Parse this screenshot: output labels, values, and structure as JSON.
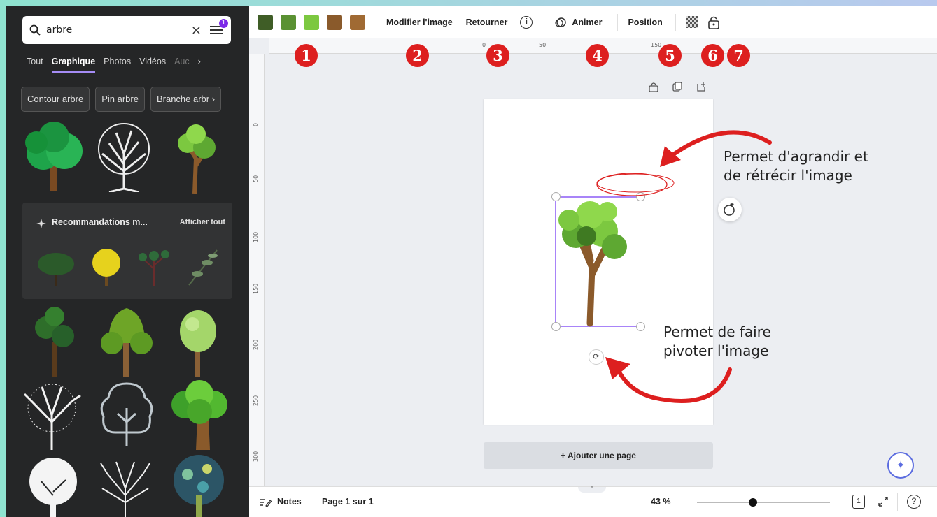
{
  "search": {
    "query": "arbre",
    "clear_icon": "×",
    "filter_badge": "1"
  },
  "tabs": [
    "Tout",
    "Graphique",
    "Photos",
    "Vidéos",
    "Auc"
  ],
  "tab_more": "›",
  "chips": [
    "Contour arbre",
    "Pin arbre",
    "Branche arbr"
  ],
  "chip_more": "›",
  "recommendations": {
    "title": "Recommandations m...",
    "see_all": "Afficher tout"
  },
  "toolbar": {
    "colors": [
      "#3f5d26",
      "#5a9132",
      "#7cc840",
      "#8a5a2b",
      "#a06a33"
    ],
    "edit_image": "Modifier l'image",
    "flip": "Retourner",
    "info": "i",
    "animate": "Animer",
    "position": "Position"
  },
  "markers": [
    "1",
    "2",
    "3",
    "4",
    "5",
    "6",
    "7"
  ],
  "ruler": {
    "top": [
      "0",
      "50",
      "150"
    ],
    "left": [
      "0",
      "50",
      "100",
      "150",
      "200",
      "250",
      "300"
    ]
  },
  "canvas": {
    "add_page": "+ Ajouter une page"
  },
  "annotations": {
    "resize_line1": "Permet d'agrandir et",
    "resize_line2": "de rétrécir l'image",
    "rotate_line1": "Permet de faire",
    "rotate_line2": "pivoter l'image"
  },
  "bottom": {
    "notes": "Notes",
    "page": "Page 1 sur 1",
    "zoom": "43 %",
    "help": "?",
    "page_count": "1"
  }
}
